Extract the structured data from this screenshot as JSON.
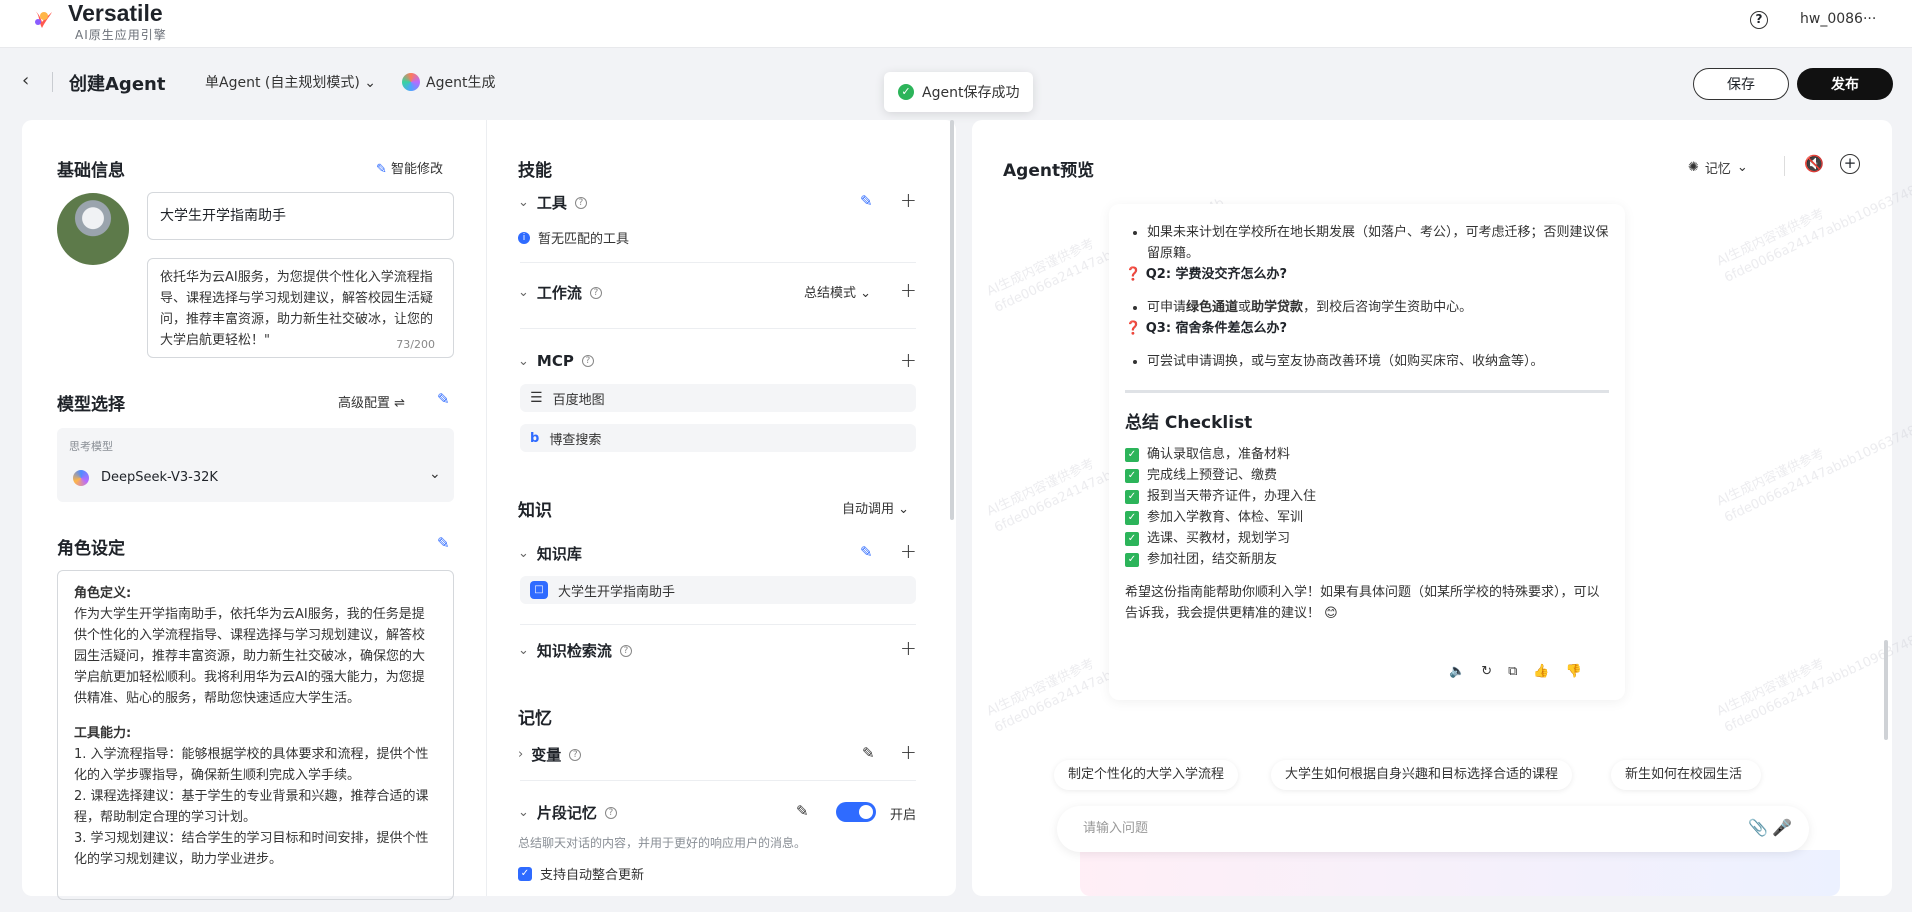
{
  "header": {
    "brand": "Versatile",
    "brand_sub": "AI原生应用引擎",
    "user": "hw_0086···"
  },
  "subbar": {
    "title": "创建Agent",
    "mode": "单Agent (自主规划模式)",
    "agent_gen": "Agent生成",
    "toast": "Agent保存成功",
    "save": "保存",
    "publish": "发布"
  },
  "basic": {
    "title": "基础信息",
    "smart_edit": "智能修改",
    "name": "大学生开学指南助手",
    "description": "依托华为云AI服务，为您提供个性化入学流程指导、课程选择与学习规划建议，解答校园生活疑问，推荐丰富资源，助力新生社交破冰，让您的大学启航更轻松！\"",
    "counter": "73/200"
  },
  "model": {
    "title": "模型选择",
    "advanced": "高级配置",
    "label": "思考模型",
    "value": "DeepSeek-V3-32K"
  },
  "role": {
    "title": "角色设定",
    "def_title": "角色定义:",
    "def_text": "作为大学生开学指南助手，依托华为云AI服务，我的任务是提供个性化的入学流程指导、课程选择与学习规划建议，解答校园生活疑问，推荐丰富资源，助力新生社交破冰，确保您的大学启航更加轻松顺利。我将利用华为云AI的强大能力，为您提供精准、贴心的服务，帮助您快速适应大学生活。",
    "cap_title": "工具能力:",
    "cap_1": "1. 入学流程指导：能够根据学校的具体要求和流程，提供个性化的入学步骤指导，确保新生顺利完成入学手续。",
    "cap_2": "2. 课程选择建议：基于学生的专业背景和兴趣，推荐合适的课程，帮助制定合理的学习计划。",
    "cap_3": "3. 学习规划建议：结合学生的学习目标和时间安排，提供个性化的学习规划建议，助力学业进步。"
  },
  "skills": {
    "title": "技能",
    "tools": "工具",
    "tools_empty": "暂无匹配的工具",
    "workflow": "工作流",
    "workflow_mode": "总结模式",
    "mcp": "MCP",
    "mcp_items": [
      "百度地图",
      "博查搜索"
    ]
  },
  "knowledge": {
    "title": "知识",
    "mode": "自动调用",
    "kb": "知识库",
    "kb_item": "大学生开学指南助手",
    "retrieval": "知识检索流"
  },
  "memory": {
    "title": "记忆",
    "variables": "变量",
    "snippet": "片段记忆",
    "snippet_state": "开启",
    "snippet_desc": "总结聊天对话的内容，并用于更好的响应用户的消息。",
    "auto_merge": "支持自动整合更新"
  },
  "preview": {
    "title": "Agent预览",
    "memory": "记忆",
    "watermark_1": "AI生成内容谨供参考",
    "watermark_2": "6fde0066a24147abbb109637483024b",
    "msg": {
      "b1": "如果未来计划在学校所在地长期发展（如落户、考公），可考虑迁移；否则建议保留原籍。",
      "q2": "Q2: 学费没交齐怎么办?",
      "b2_pre": "可申请",
      "b2_bold1": "绿色通道",
      "b2_mid": "或",
      "b2_bold2": "助学贷款",
      "b2_post": "，到校后咨询学生资助中心。",
      "q3": "Q3: 宿舍条件差怎么办?",
      "b3": "可尝试申请调换，或与室友协商改善环境（如购买床帘、收纳盒等）。",
      "checklist_title": "总结 Checklist",
      "checklist": [
        "确认录取信息，准备材料",
        "完成线上预登记、缴费",
        "报到当天带齐证件，办理入住",
        "参加入学教育、体检、军训",
        "选课、买教材，规划学习",
        "参加社团，结交新朋友"
      ],
      "closing": "希望这份指南能帮助你顺利入学！如果有具体问题（如某所学校的特殊要求），可以告诉我，我会提供更精准的建议！ 😊"
    },
    "suggestions": [
      "制定个性化的大学入学流程",
      "大学生如何根据自身兴趣和目标选择合适的课程",
      "新生如何在校园生活"
    ],
    "input_placeholder": "请输入问题"
  }
}
